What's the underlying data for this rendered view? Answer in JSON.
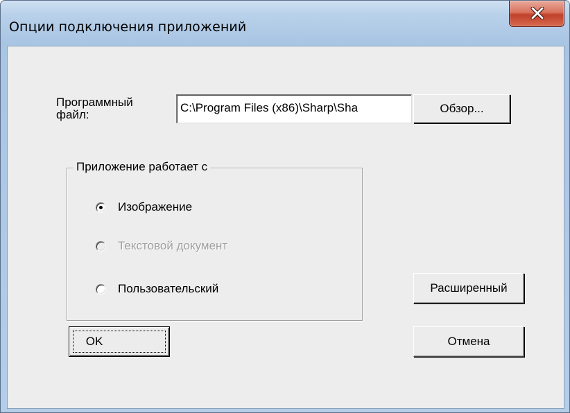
{
  "window": {
    "title": "Опции подключения приложений",
    "close_glyph": "X"
  },
  "program": {
    "label_line1": "Программный",
    "label_line2": "файл:",
    "path_value": "C:\\Program Files (x86)\\Sharp\\Sha",
    "browse_label": "Обзор..."
  },
  "group": {
    "title": "Приложение работает с",
    "options": [
      {
        "label": "Изображение",
        "checked": true,
        "enabled": true
      },
      {
        "label": "Текстовой документ",
        "checked": false,
        "enabled": false
      },
      {
        "label": "Пользовательский",
        "checked": false,
        "enabled": true
      }
    ]
  },
  "buttons": {
    "advanced_label": "Расширенный",
    "ok_label": "OK",
    "cancel_label": "Отмена"
  },
  "colors": {
    "frame_accent": "#b9d1ea",
    "client_bg": "#ededed",
    "close_red": "#c0412a"
  }
}
